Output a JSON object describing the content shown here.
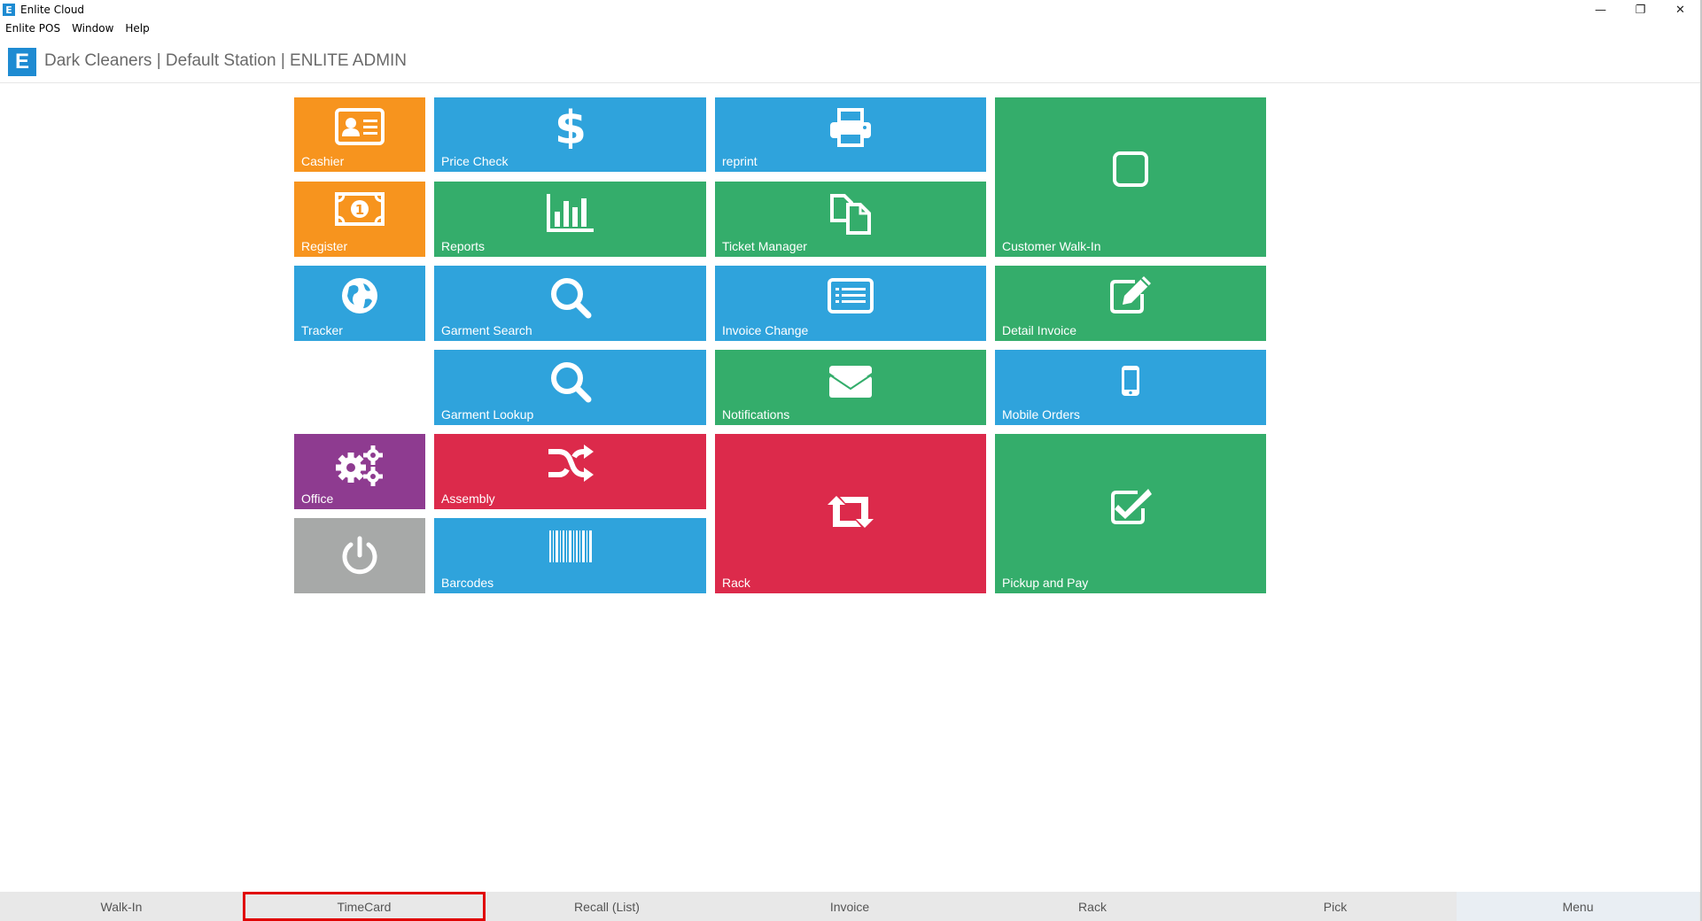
{
  "window": {
    "title": "Enlite Cloud",
    "app_icon_letter": "E",
    "controls": {
      "minimize": "—",
      "restore": "❐",
      "close": "✕"
    }
  },
  "menubar": [
    "Enlite POS",
    "Window",
    "Help"
  ],
  "header": {
    "logo_letter": "E",
    "title": "Dark Cleaners | Default Station | ENLITE ADMIN"
  },
  "colors": {
    "orange": "#f7941e",
    "blue": "#2fa3dc",
    "green": "#34ad6b",
    "purple": "#8e3b90",
    "red": "#dc2a4b",
    "grey": "#a7a9a8",
    "brand": "#1e8bd2"
  },
  "tiles": {
    "cashier": {
      "label": "Cashier",
      "icon": "id-card-icon"
    },
    "price_check": {
      "label": "Price Check",
      "icon": "dollar-icon"
    },
    "reprint": {
      "label": "reprint",
      "icon": "printer-icon"
    },
    "customer_walkin": {
      "label": "Customer Walk-In",
      "icon": "square-icon"
    },
    "register": {
      "label": "Register",
      "icon": "money-bill-icon"
    },
    "reports": {
      "label": "Reports",
      "icon": "bar-chart-icon"
    },
    "ticket_manager": {
      "label": "Ticket Manager",
      "icon": "copy-icon"
    },
    "tracker": {
      "label": "Tracker",
      "icon": "globe-icon"
    },
    "garment_search": {
      "label": "Garment Search",
      "icon": "search-icon"
    },
    "invoice_change": {
      "label": "Invoice Change",
      "icon": "list-icon"
    },
    "detail_invoice": {
      "label": "Detail Invoice",
      "icon": "edit-icon"
    },
    "garment_lookup": {
      "label": "Garment Lookup",
      "icon": "search-icon"
    },
    "notifications": {
      "label": "Notifications",
      "icon": "envelope-icon"
    },
    "mobile_orders": {
      "label": "Mobile Orders",
      "icon": "mobile-icon"
    },
    "office": {
      "label": "Office",
      "icon": "gears-icon"
    },
    "assembly": {
      "label": "Assembly",
      "icon": "shuffle-icon"
    },
    "rack": {
      "label": "Rack",
      "icon": "retweet-icon"
    },
    "pickup_and_pay": {
      "label": "Pickup and Pay",
      "icon": "check-square-icon"
    },
    "power": {
      "label": "",
      "icon": "power-icon"
    },
    "barcodes": {
      "label": "Barcodes",
      "icon": "barcode-icon"
    }
  },
  "bottom_nav": {
    "walkin": "Walk-In",
    "timecard": "TimeCard",
    "recall": "Recall (List)",
    "invoice": "Invoice",
    "rack": "Rack",
    "pick": "Pick",
    "menu": "Menu"
  }
}
